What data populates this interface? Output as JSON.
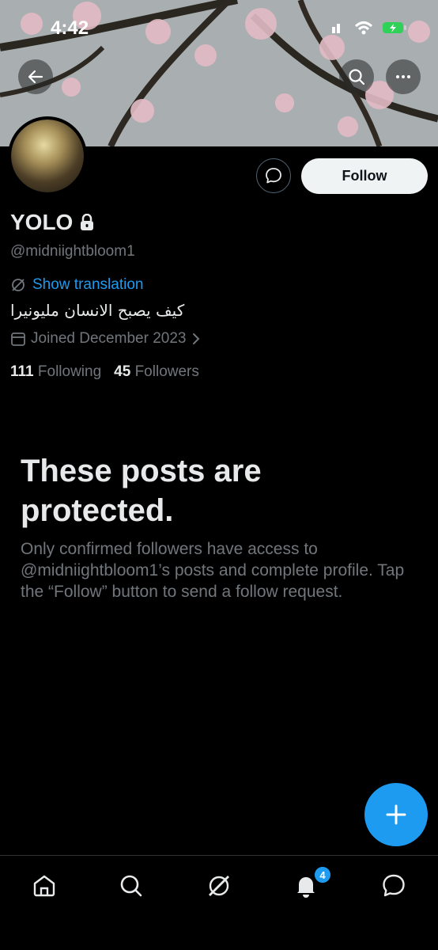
{
  "status_bar": {
    "time": "4:42"
  },
  "profile": {
    "name": "YOLO",
    "handle": "@midniightbloom1",
    "translate_label": "Show translation",
    "bio": "كيف يصبح الانسان مليونيرا",
    "joined": "Joined December 2023",
    "following_count": "111",
    "following_label": "Following",
    "followers_count": "45",
    "followers_label": "Followers",
    "follow_label": "Follow"
  },
  "protected": {
    "title": "These posts are protected.",
    "body": "Only confirmed followers have access to @midniightbloom1’s posts and complete profile. Tap the “Follow” button to send a follow request."
  },
  "tabbar": {
    "notifications_badge": "4"
  },
  "colors": {
    "accent": "#1d9bf0",
    "background": "#000000",
    "secondary_text": "#71767b"
  },
  "icons": [
    "back-arrow-icon",
    "search-icon",
    "more-icon",
    "lock-icon",
    "translate-icon",
    "calendar-icon",
    "chevron-right-icon",
    "message-icon",
    "compose-plus-icon",
    "home-icon",
    "explore-icon",
    "grok-icon",
    "bell-icon",
    "chat-icon"
  ]
}
